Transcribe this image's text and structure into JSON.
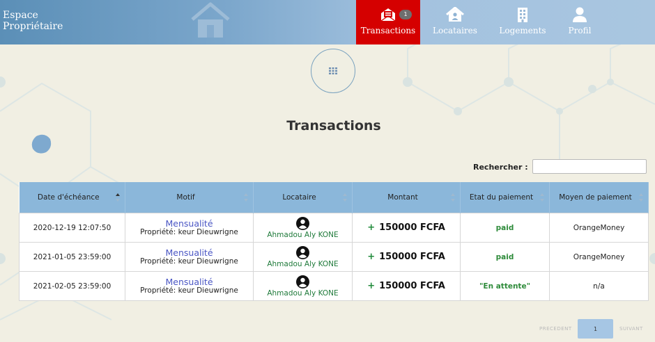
{
  "brand": {
    "line1": "Espace",
    "line2": "Propriétaire"
  },
  "nav": {
    "items": [
      {
        "label": "Transactions",
        "icon": "envelope-list-icon",
        "badge": "1",
        "active": true
      },
      {
        "label": "Locataires",
        "icon": "house-user-icon"
      },
      {
        "label": "Logements",
        "icon": "building-icon"
      },
      {
        "label": "Profil",
        "icon": "user-icon"
      }
    ]
  },
  "grid_button": {
    "icon": "grid-icon"
  },
  "page": {
    "title": "Transactions"
  },
  "search": {
    "label": "Rechercher :",
    "value": ""
  },
  "table": {
    "columns": [
      "Date d'échéance",
      "Motif",
      "Locataire",
      "Montant",
      "Etat du paiement",
      "Moyen de paiement"
    ],
    "rows": [
      {
        "date": "2020-12-19 12:07:50",
        "motif": "Mensualité",
        "property": "Propriété: keur Dieuwrigne",
        "tenant": "Ahmadou Aly KONE",
        "sign": "+",
        "amount": "150000 FCFA",
        "status": "paid",
        "method": "OrangeMoney"
      },
      {
        "date": "2021-01-05 23:59:00",
        "motif": "Mensualité",
        "property": "Propriété: keur Dieuwrigne",
        "tenant": "Ahmadou Aly KONE",
        "sign": "+",
        "amount": "150000 FCFA",
        "status": "paid",
        "method": "OrangeMoney"
      },
      {
        "date": "2021-02-05 23:59:00",
        "motif": "Mensualité",
        "property": "Propriété: keur Dieuwrigne",
        "tenant": "Ahmadou Aly KONE",
        "sign": "+",
        "amount": "150000 FCFA",
        "status": "\"En attente\"",
        "method": "n/a"
      }
    ]
  },
  "pagination": {
    "prev": "PRECEDENT",
    "page": "1",
    "next": "SUIVANT"
  },
  "colors": {
    "nav_active": "#d50000",
    "header": "#8bb7da",
    "status_green": "#2e8b3a",
    "link": "#4a56c4"
  }
}
